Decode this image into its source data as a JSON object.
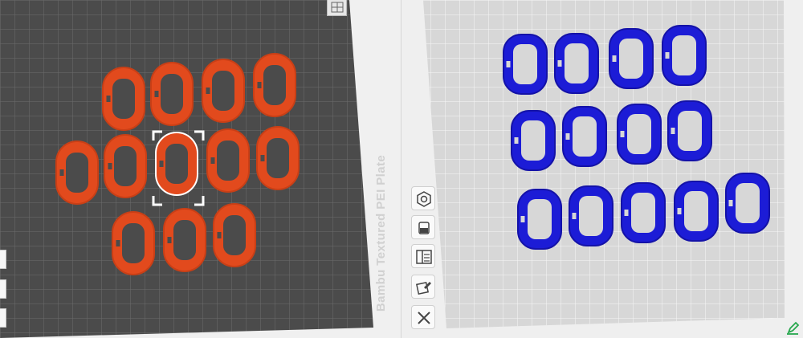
{
  "left_plate": {
    "label": "Bambu Textured PEI Plate",
    "part_color": "#e24a1d",
    "plate_color": "#4b4b4b",
    "grid_color": "#8a8a8a",
    "selected_part": "center"
  },
  "right_plate": {
    "part_color": "#1c1cd6",
    "plate_color": "#d7d7d7",
    "grid_color": "#ffffff"
  },
  "toolbar": {
    "buttons": [
      {
        "name": "orient-button",
        "icon": "nut-icon"
      },
      {
        "name": "supports-button",
        "icon": "paint-bucket-icon"
      },
      {
        "name": "layout-button",
        "icon": "panel-layout-icon"
      },
      {
        "name": "edit-object-button",
        "icon": "pencil-edit-icon"
      },
      {
        "name": "close-button",
        "icon": "close-icon"
      }
    ]
  },
  "status": {
    "icon": "green-edit-icon"
  }
}
